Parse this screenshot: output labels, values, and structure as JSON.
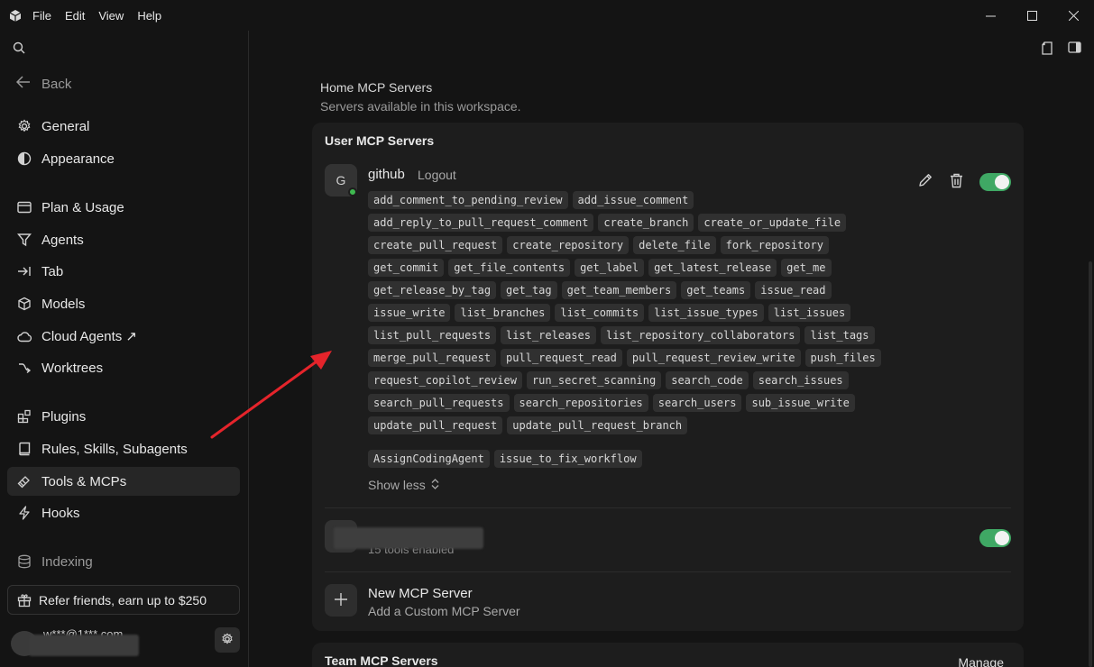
{
  "menu": [
    "File",
    "Edit",
    "View",
    "Help"
  ],
  "sidebar": {
    "back": "Back",
    "items": [
      {
        "label": "General",
        "icon": "gear-icon"
      },
      {
        "label": "Appearance",
        "icon": "palette-icon"
      },
      {
        "label": "Plan & Usage",
        "icon": "card-icon"
      },
      {
        "label": "Agents",
        "icon": "funnel-icon"
      },
      {
        "label": "Tab",
        "icon": "tab-arrow-icon"
      },
      {
        "label": "Models",
        "icon": "cube-icon"
      },
      {
        "label": "Cloud Agents ↗",
        "icon": "cloud-icon"
      },
      {
        "label": "Worktrees",
        "icon": "branch-icon"
      },
      {
        "label": "Plugins",
        "icon": "plugin-icon"
      },
      {
        "label": "Rules, Skills, Subagents",
        "icon": "book-icon"
      },
      {
        "label": "Tools & MCPs",
        "icon": "tools-icon"
      },
      {
        "label": "Hooks",
        "icon": "bolt-icon"
      },
      {
        "label": "Indexing",
        "icon": "database-icon"
      }
    ],
    "refer": "Refer friends, earn up to $250",
    "email": "w***@1***.com"
  },
  "main": {
    "title": "Home MCP Servers",
    "subtitle": "Servers available in this workspace.",
    "user_heading": "User MCP Servers",
    "server": {
      "avatar_letter": "G",
      "name": "github",
      "logout": "Logout",
      "tools": [
        "add_comment_to_pending_review",
        "add_issue_comment",
        "add_reply_to_pull_request_comment",
        "create_branch",
        "create_or_update_file",
        "create_pull_request",
        "create_repository",
        "delete_file",
        "fork_repository",
        "get_commit",
        "get_file_contents",
        "get_label",
        "get_latest_release",
        "get_me",
        "get_release_by_tag",
        "get_tag",
        "get_team_members",
        "get_teams",
        "issue_read",
        "issue_write",
        "list_branches",
        "list_commits",
        "list_issue_types",
        "list_issues",
        "list_pull_requests",
        "list_releases",
        "list_repository_collaborators",
        "list_tags",
        "merge_pull_request",
        "pull_request_read",
        "pull_request_review_write",
        "push_files",
        "request_copilot_review",
        "run_secret_scanning",
        "search_code",
        "search_issues",
        "search_pull_requests",
        "search_repositories",
        "search_users",
        "sub_issue_write",
        "update_pull_request",
        "update_pull_request_branch"
      ],
      "extra_tools": [
        "AssignCodingAgent",
        "issue_to_fix_workflow"
      ],
      "show_less": "Show less"
    },
    "server2": {
      "sub": "15 tools enabled"
    },
    "new_server": {
      "title": "New MCP Server",
      "sub": "Add a Custom MCP Server"
    },
    "team_heading": "Team MCP Servers",
    "manage": "Manage",
    "toggle_color": "#3fa864",
    "status_color": "#3fb950",
    "arrow_color": "#e5242b"
  }
}
